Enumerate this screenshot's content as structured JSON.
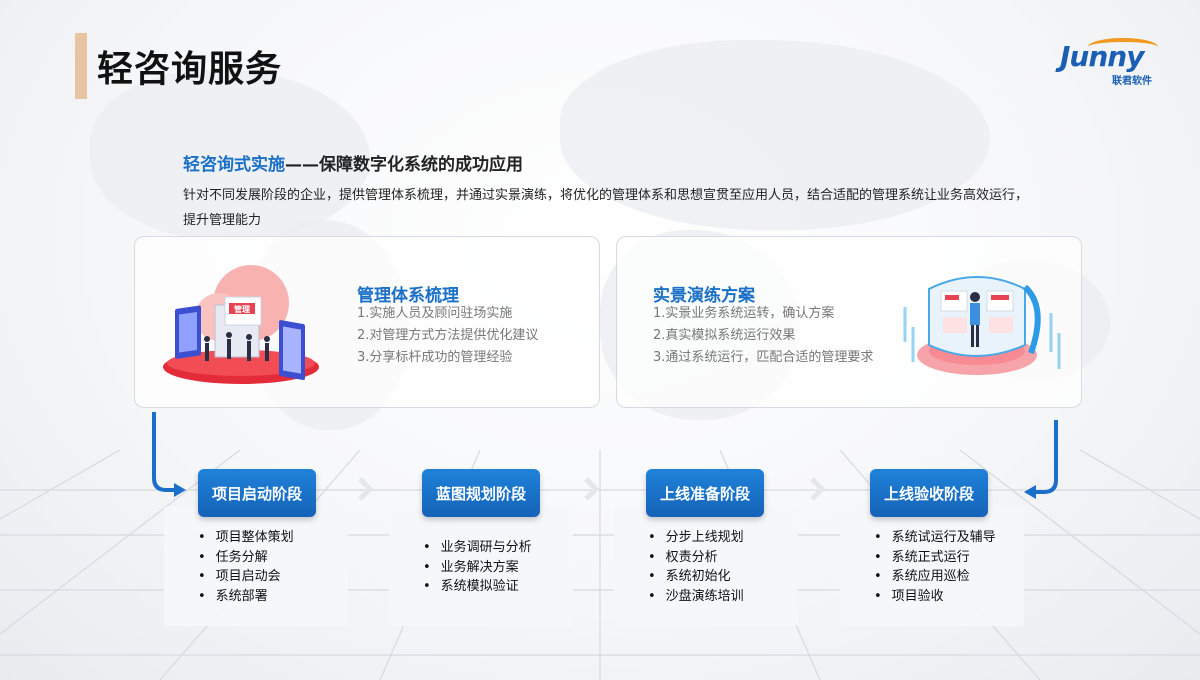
{
  "header": {
    "title": "轻咨询服务",
    "logo_text": "Junny",
    "logo_sub": "联君软件"
  },
  "intro": {
    "headline_blue": "轻咨询式实施",
    "headline_rest": "——保障数字化系统的成功应用",
    "description": "针对不同发展阶段的企业，提供管理体系梳理，并通过实景演练，将优化的管理体系和思想宣贯至应用人员，结合适配的管理系统让业务高效运行，提升管理能力"
  },
  "cards": [
    {
      "title": "管理体系梳理",
      "items": [
        "1.实施人员及顾问驻场实施",
        "2.对管理方式方法提供优化建议",
        "3.分享标杆成功的管理经验"
      ],
      "illustration_label": "管理"
    },
    {
      "title": "实景演练方案",
      "items": [
        "1.实景业务系统运转，确认方案",
        "2.真实模拟系统运行效果",
        "3.通过系统运行，匹配合适的管理要求"
      ]
    }
  ],
  "stages": [
    {
      "label": "项目启动阶段",
      "items": [
        "项目整体策划",
        "任务分解",
        "项目启动会",
        "系统部署"
      ]
    },
    {
      "label": "蓝图规划阶段",
      "items": [
        "业务调研与分析",
        "业务解决方案",
        "系统模拟验证"
      ]
    },
    {
      "label": "上线准备阶段",
      "items": [
        "分步上线规划",
        "权责分析",
        "系统初始化",
        "沙盘演练培训"
      ]
    },
    {
      "label": "上线验收阶段",
      "items": [
        "系统试运行及辅导",
        "系统正式运行",
        "系统应用巡检",
        "项目验收"
      ]
    }
  ],
  "colors": {
    "accent_blue": "#1a6fc6",
    "button_blue": "#1b74cc",
    "title_bar": "#e8c5a2",
    "logo_orange": "#f29a1f"
  }
}
